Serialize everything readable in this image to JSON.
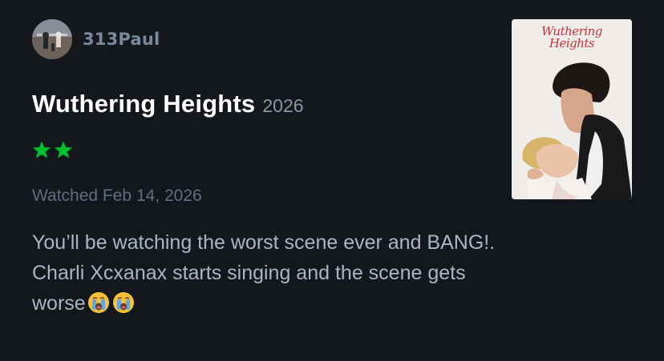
{
  "review": {
    "author": {
      "username": "313Paul",
      "avatar_icon": "avatar-photo"
    },
    "film": {
      "title": "Wuthering Heights",
      "year": "2026",
      "poster": {
        "title_line1": "Wuthering",
        "title_line2": "Heights"
      }
    },
    "rating": {
      "stars": 2,
      "max_stars": 5,
      "star_color": "#00c030"
    },
    "watched": "Watched Feb 14, 2026",
    "text": {
      "line1": "You’ll be watching the worst scene ever and BANG!.",
      "line2": "Charli Xcxanax starts singing and the scene gets",
      "line3": "worse",
      "trailing_emoji": [
        "loudly-crying-face-emoji",
        "loudly-crying-face-emoji"
      ]
    }
  },
  "colors": {
    "background": "#14181c",
    "title": "#ffffff",
    "muted": "#5f6d7c",
    "body_text": "#a8b6c4"
  }
}
